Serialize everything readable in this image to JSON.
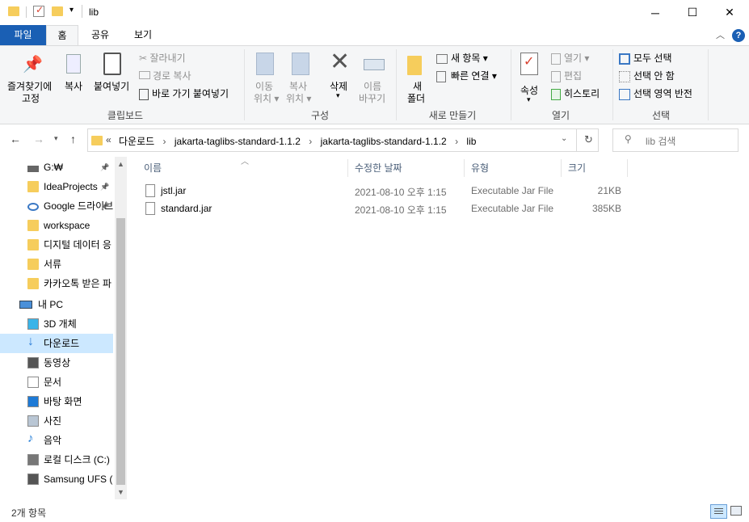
{
  "window": {
    "title": "lib",
    "minimize": "─",
    "maximize": "☐",
    "close": "✕"
  },
  "ribbon_tabs": [
    "파일",
    "홈",
    "공유",
    "보기"
  ],
  "ribbon": {
    "clipboard": {
      "pin": [
        "즐겨찾기에",
        "고정"
      ],
      "copy": "복사",
      "paste": "붙여넣기",
      "cut": "잘라내기",
      "copy_path": "경로 복사",
      "paste_shortcut": "바로 가기 붙여넣기",
      "label": "클립보드"
    },
    "organize": {
      "move_to": [
        "이동",
        "위치"
      ],
      "copy_to": [
        "복사",
        "위치"
      ],
      "delete": "삭제",
      "rename": [
        "이름",
        "바꾸기"
      ],
      "label": "구성"
    },
    "new": {
      "new_folder": [
        "새",
        "폴더"
      ],
      "new_item": "새 항목",
      "easy_access": "빠른 연결",
      "label": "새로 만들기"
    },
    "open": {
      "properties": "속성",
      "open": "열기",
      "edit": "편집",
      "history": "히스토리",
      "label": "열기"
    },
    "select": {
      "select_all": "모두 선택",
      "select_none": "선택 안 함",
      "invert": "선택 영역 반전",
      "label": "선택"
    }
  },
  "address": {
    "overflow": "«",
    "crumbs": [
      "다운로드",
      "jakarta-taglibs-standard-1.1.2",
      "jakarta-taglibs-standard-1.1.2",
      "lib"
    ],
    "search_placeholder": "lib 검색"
  },
  "nav": {
    "quick": [
      {
        "label": "G:₩",
        "pinned": true
      },
      {
        "label": "IdeaProjects",
        "pinned": true
      },
      {
        "label": "Google 드라이브",
        "pinned": true
      },
      {
        "label": "workspace",
        "pinned": false
      },
      {
        "label": "디지털 데이터 응",
        "pinned": false
      },
      {
        "label": "서류",
        "pinned": false
      },
      {
        "label": "카카오톡 받은 파",
        "pinned": false
      }
    ],
    "this_pc": "내 PC",
    "pc_items": [
      "3D 개체",
      "다운로드",
      "동영상",
      "문서",
      "바탕 화면",
      "사진",
      "음악",
      "로컬 디스크 (C:)",
      "Samsung UFS (D:)"
    ]
  },
  "columns": [
    "이름",
    "수정한 날짜",
    "유형",
    "크기"
  ],
  "files": [
    {
      "name": "jstl.jar",
      "modified": "2021-08-10 오후 1:15",
      "type": "Executable Jar File",
      "size": "21KB"
    },
    {
      "name": "standard.jar",
      "modified": "2021-08-10 오후 1:15",
      "type": "Executable Jar File",
      "size": "385KB"
    }
  ],
  "status": {
    "count": "2개 항목"
  },
  "colors": {
    "file_tab": "#1a5fb4",
    "selected": "#cce8ff",
    "folder": "#f6cd5c"
  }
}
